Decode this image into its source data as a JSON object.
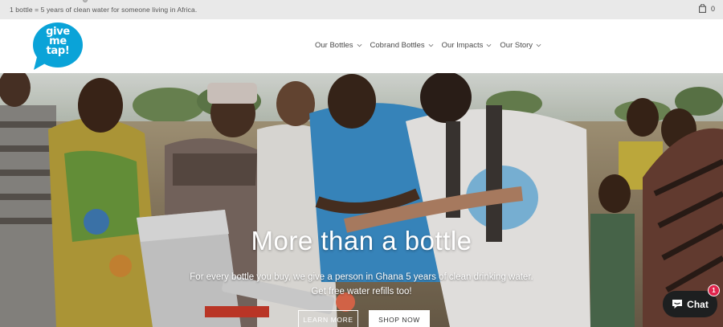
{
  "topbar": {
    "promo": "1 bottle = 5 years of clean water for someone living in Africa.",
    "cart_icon": "shopping-bag-icon",
    "cart_count": "0"
  },
  "logo": {
    "line1": "give",
    "line2": "me",
    "line3": "tap!",
    "color": "#0aa3d8"
  },
  "nav": {
    "items": [
      {
        "label": "Our Bottles"
      },
      {
        "label": "Cobrand Bottles"
      },
      {
        "label": "Our Impacts"
      },
      {
        "label": "Our Story"
      }
    ],
    "dropdown_icon": "chevron-down-icon"
  },
  "hero": {
    "title": "More than a bottle",
    "subtitle_line1": "For every bottle you buy, we give a person in Ghana 5 years of clean drinking water.",
    "subtitle_line2": "Get free water refills too!",
    "learn_more": "LEARN MORE",
    "shop_now": "SHOP NOW"
  },
  "chat": {
    "label": "Chat",
    "badge": "1",
    "icon": "chat-bubble-icon"
  },
  "colors": {
    "brand": "#0aa3d8",
    "topbar_bg": "#e9e9e9",
    "chat_bg": "#1d1f20",
    "badge": "#e0244c"
  }
}
